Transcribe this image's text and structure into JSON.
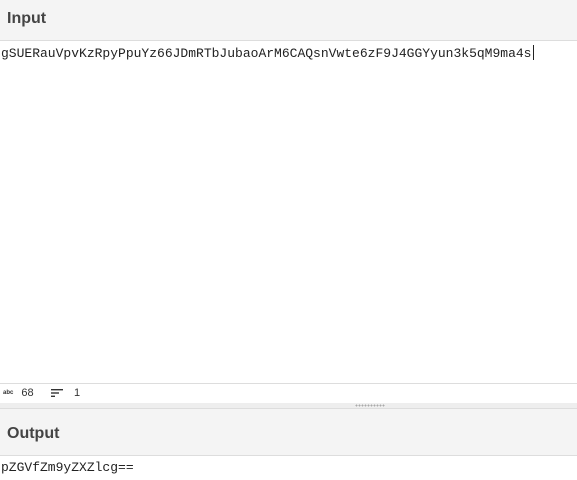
{
  "input": {
    "title": "Input",
    "value": "gSUERauVpvKzRpyPpuYz66JDmRTbJubaoArM6CAQsnVwte6zF9J4GGYyun3k5qM9ma4s"
  },
  "status": {
    "abc_icon": "abc",
    "length": "68",
    "lines": "1",
    "icons": [
      "abc-icon",
      "sort-lines-icon"
    ]
  },
  "output": {
    "title": "Output",
    "value": "pZGVfZm9yZXZlcg=="
  }
}
